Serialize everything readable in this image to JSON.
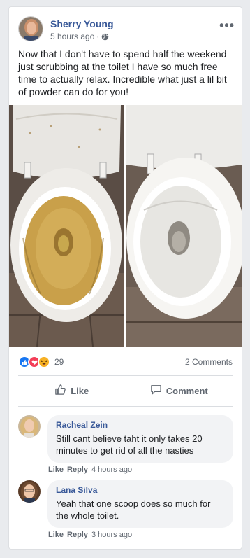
{
  "post": {
    "author": "Sherry Young",
    "time": "5 hours ago",
    "separator": "·",
    "text": "Now that I don't have to spend half the weekend just scrubbing at the toilet I have so much free time to actually relax. Incredible what just a lil bit of powder can do for you!",
    "reaction_count": "29",
    "comments_count": "2 Comments"
  },
  "actions": {
    "like_label": "Like",
    "comment_label": "Comment"
  },
  "comments": [
    {
      "name": "Racheal Zein",
      "text": "Still cant believe taht it only takes 20 minutes to get rid of all the nasties",
      "like": "Like",
      "reply": "Reply",
      "time": "4 hours ago"
    },
    {
      "name": "Lana Silva",
      "text": "Yeah that one scoop does so much for the whole toilet.",
      "like": "Like",
      "reply": "Reply",
      "time": "3 hours ago"
    }
  ],
  "icons": {
    "globe": "globe-icon",
    "more": "more-options-icon",
    "like": "thumbs-up-icon",
    "comment": "speech-bubble-icon"
  },
  "colors": {
    "link_blue": "#385898",
    "like_blue": "#1877f2",
    "love_red": "#f33e58",
    "haha_yellow": "#f7b125"
  }
}
